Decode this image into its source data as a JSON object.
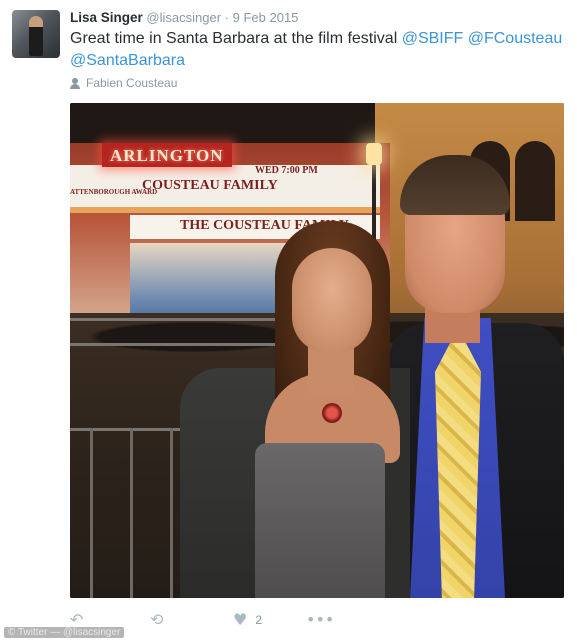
{
  "tweet": {
    "author_name": "Lisa Singer",
    "handle": "@lisacsinger",
    "separator": "·",
    "date": "9 Feb 2015",
    "text_plain": "Great time in Santa Barbara at the film festival ",
    "mentions": [
      "@SBIFF",
      "@FCousteau",
      "@SantaBarbara"
    ],
    "retweeted_by": "Fabien Cousteau",
    "likes": "2"
  },
  "photo": {
    "sign": "ARLINGTON",
    "marquee_line1": "COUSTEAU FAMILY",
    "marquee_line2": "THE COUSTEAU FAMILY",
    "marquee_small": "WED 7:00 PM",
    "marquee_award": "ATTENBOROUGH AWARD"
  },
  "watermark": "© Twitter — @lisacsinger",
  "icons": [
    "reply-icon",
    "retweet-icon",
    "heart-icon",
    "more-icon",
    "person-icon"
  ]
}
